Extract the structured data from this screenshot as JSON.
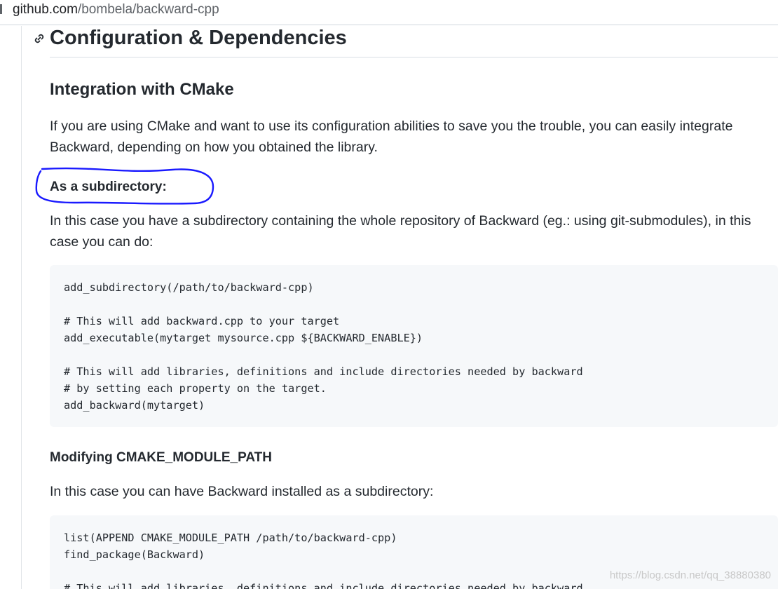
{
  "browser": {
    "url_host": "github.com",
    "url_path": "/bombela/backward-cpp"
  },
  "article": {
    "h2": "Configuration & Dependencies",
    "h3": "Integration with CMake",
    "intro": "If you are using CMake and want to use its configuration abilities to save you the trouble, you can easily integrate Backward, depending on how you obtained the library.",
    "section1": {
      "title": "As a subdirectory:",
      "text": "In this case you have a subdirectory containing the whole repository of Backward (eg.: using git-submodules), in this case you can do:",
      "code": [
        "add_subdirectory(/path/to/backward-cpp)",
        "",
        "# This will add backward.cpp to your target",
        "add_executable(mytarget mysource.cpp ${BACKWARD_ENABLE})",
        "",
        "# This will add libraries, definitions and include directories needed by backward",
        "# by setting each property on the target.",
        "add_backward(mytarget)"
      ]
    },
    "section2": {
      "title": "Modifying CMAKE_MODULE_PATH",
      "text": "In this case you can have Backward installed as a subdirectory:",
      "code": [
        "list(APPEND CMAKE_MODULE_PATH /path/to/backward-cpp)",
        "find_package(Backward)",
        "",
        "# This will add libraries, definitions and include directories needed by backward"
      ]
    }
  },
  "watermark": "https://blog.csdn.net/qq_38880380",
  "colors": {
    "annotation_ink": "#1a1aff",
    "code_bg": "#f6f8fa"
  }
}
